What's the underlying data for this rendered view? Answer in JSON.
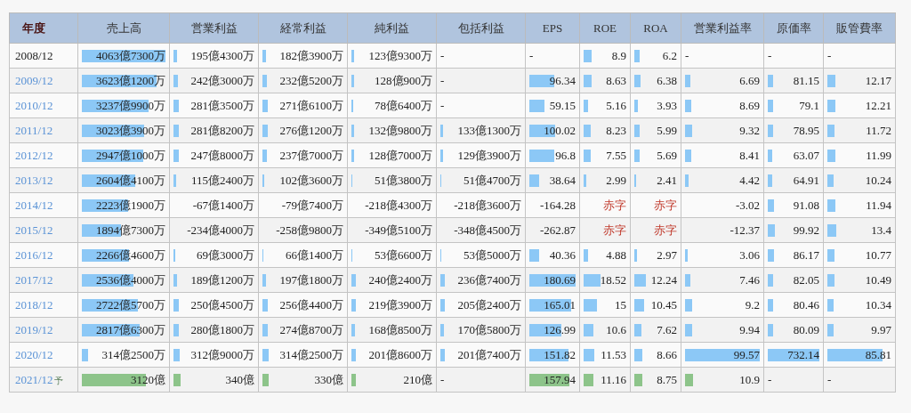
{
  "table": {
    "columns": [
      "年度",
      "売上高",
      "営業利益",
      "経常利益",
      "純利益",
      "包括利益",
      "EPS",
      "ROE",
      "ROA",
      "営業利益率",
      "原価率",
      "販管費率"
    ],
    "rows": [
      {
        "kind": "actual",
        "cells": [
          {
            "kind": "year",
            "text": "2008/12",
            "linked": false
          },
          {
            "kind": "value",
            "text": "4063億7300万",
            "level": 1.0
          },
          {
            "kind": "value",
            "text": "195億4300万",
            "level": 0.048
          },
          {
            "kind": "value",
            "text": "182億3900万",
            "level": 0.045
          },
          {
            "kind": "value",
            "text": "123億9300万",
            "level": 0.03
          },
          {
            "kind": "empty",
            "text": "-"
          },
          {
            "kind": "empty",
            "text": "-"
          },
          {
            "kind": "value",
            "text": "8.9",
            "level": 0.185
          },
          {
            "kind": "value",
            "text": "6.2",
            "level": 0.135
          },
          {
            "kind": "empty",
            "text": "-"
          },
          {
            "kind": "empty",
            "text": "-"
          },
          {
            "kind": "empty",
            "text": "-"
          }
        ]
      },
      {
        "kind": "actual",
        "cells": [
          {
            "kind": "year",
            "text": "2009/12",
            "linked": true
          },
          {
            "kind": "value",
            "text": "3623億1200万",
            "level": 0.89
          },
          {
            "kind": "value",
            "text": "242億3000万",
            "level": 0.06
          },
          {
            "kind": "value",
            "text": "232億5200万",
            "level": 0.057
          },
          {
            "kind": "value",
            "text": "128億900万",
            "level": 0.032
          },
          {
            "kind": "empty",
            "text": "-"
          },
          {
            "kind": "value",
            "text": "96.34",
            "level": 0.53
          },
          {
            "kind": "value",
            "text": "8.63",
            "level": 0.18
          },
          {
            "kind": "value",
            "text": "6.38",
            "level": 0.14
          },
          {
            "kind": "value",
            "text": "6.69",
            "level": 0.067
          },
          {
            "kind": "value",
            "text": "81.15",
            "level": 0.111
          },
          {
            "kind": "value",
            "text": "12.17",
            "level": 0.122
          }
        ]
      },
      {
        "kind": "actual",
        "cells": [
          {
            "kind": "year",
            "text": "2010/12",
            "linked": true
          },
          {
            "kind": "value",
            "text": "3237億9900万",
            "level": 0.8
          },
          {
            "kind": "value",
            "text": "281億3500万",
            "level": 0.069
          },
          {
            "kind": "value",
            "text": "271億6100万",
            "level": 0.067
          },
          {
            "kind": "value",
            "text": "78億6400万",
            "level": 0.019
          },
          {
            "kind": "empty",
            "text": "-"
          },
          {
            "kind": "value",
            "text": "59.15",
            "level": 0.33
          },
          {
            "kind": "value",
            "text": "5.16",
            "level": 0.11
          },
          {
            "kind": "value",
            "text": "3.93",
            "level": 0.085
          },
          {
            "kind": "value",
            "text": "8.69",
            "level": 0.087
          },
          {
            "kind": "value",
            "text": "79.1",
            "level": 0.108
          },
          {
            "kind": "value",
            "text": "12.21",
            "level": 0.122
          }
        ]
      },
      {
        "kind": "actual",
        "cells": [
          {
            "kind": "year",
            "text": "2011/12",
            "linked": true
          },
          {
            "kind": "value",
            "text": "3023億3900万",
            "level": 0.74
          },
          {
            "kind": "value",
            "text": "281億8200万",
            "level": 0.069
          },
          {
            "kind": "value",
            "text": "276億1200万",
            "level": 0.068
          },
          {
            "kind": "value",
            "text": "132億9800万",
            "level": 0.033
          },
          {
            "kind": "value",
            "text": "133億1300万",
            "level": 0.033
          },
          {
            "kind": "value",
            "text": "100.02",
            "level": 0.55
          },
          {
            "kind": "value",
            "text": "8.23",
            "level": 0.17
          },
          {
            "kind": "value",
            "text": "5.99",
            "level": 0.13
          },
          {
            "kind": "value",
            "text": "9.32",
            "level": 0.093
          },
          {
            "kind": "value",
            "text": "78.95",
            "level": 0.108
          },
          {
            "kind": "value",
            "text": "11.72",
            "level": 0.117
          }
        ]
      },
      {
        "kind": "actual",
        "cells": [
          {
            "kind": "year",
            "text": "2012/12",
            "linked": true
          },
          {
            "kind": "value",
            "text": "2947億1000万",
            "level": 0.73
          },
          {
            "kind": "value",
            "text": "247億8000万",
            "level": 0.061
          },
          {
            "kind": "value",
            "text": "237億7000万",
            "level": 0.058
          },
          {
            "kind": "value",
            "text": "128億7000万",
            "level": 0.032
          },
          {
            "kind": "value",
            "text": "129億3900万",
            "level": 0.032
          },
          {
            "kind": "value",
            "text": "96.8",
            "level": 0.54
          },
          {
            "kind": "value",
            "text": "7.55",
            "level": 0.16
          },
          {
            "kind": "value",
            "text": "5.69",
            "level": 0.124
          },
          {
            "kind": "value",
            "text": "8.41",
            "level": 0.084
          },
          {
            "kind": "value",
            "text": "63.07",
            "level": 0.086
          },
          {
            "kind": "value",
            "text": "11.99",
            "level": 0.12
          }
        ]
      },
      {
        "kind": "actual",
        "cells": [
          {
            "kind": "year",
            "text": "2013/12",
            "linked": true
          },
          {
            "kind": "value",
            "text": "2604億4100万",
            "level": 0.64
          },
          {
            "kind": "value",
            "text": "115億2400万",
            "level": 0.028
          },
          {
            "kind": "value",
            "text": "102億3600万",
            "level": 0.025
          },
          {
            "kind": "value",
            "text": "51億3800万",
            "level": 0.013
          },
          {
            "kind": "value",
            "text": "51億4700万",
            "level": 0.013
          },
          {
            "kind": "value",
            "text": "38.64",
            "level": 0.21
          },
          {
            "kind": "value",
            "text": "2.99",
            "level": 0.06
          },
          {
            "kind": "value",
            "text": "2.41",
            "level": 0.05
          },
          {
            "kind": "value",
            "text": "4.42",
            "level": 0.044
          },
          {
            "kind": "value",
            "text": "64.91",
            "level": 0.089
          },
          {
            "kind": "value",
            "text": "10.24",
            "level": 0.102
          }
        ]
      },
      {
        "kind": "actual",
        "cells": [
          {
            "kind": "year",
            "text": "2014/12",
            "linked": true
          },
          {
            "kind": "value",
            "text": "2223億1900万",
            "level": 0.55
          },
          {
            "kind": "value",
            "text": "-67億1400万"
          },
          {
            "kind": "value",
            "text": "-79億7400万"
          },
          {
            "kind": "value",
            "text": "-218億4300万"
          },
          {
            "kind": "value",
            "text": "-218億3600万"
          },
          {
            "kind": "value",
            "text": "-164.28"
          },
          {
            "kind": "loss",
            "text": "赤字"
          },
          {
            "kind": "loss",
            "text": "赤字"
          },
          {
            "kind": "value",
            "text": "-3.02"
          },
          {
            "kind": "value",
            "text": "91.08",
            "level": 0.124
          },
          {
            "kind": "value",
            "text": "11.94",
            "level": 0.119
          }
        ]
      },
      {
        "kind": "actual",
        "cells": [
          {
            "kind": "year",
            "text": "2015/12",
            "linked": true
          },
          {
            "kind": "value",
            "text": "1894億7300万",
            "level": 0.47
          },
          {
            "kind": "value",
            "text": "-234億4000万"
          },
          {
            "kind": "value",
            "text": "-258億9800万"
          },
          {
            "kind": "value",
            "text": "-349億5100万"
          },
          {
            "kind": "value",
            "text": "-348億4500万"
          },
          {
            "kind": "value",
            "text": "-262.87"
          },
          {
            "kind": "loss",
            "text": "赤字"
          },
          {
            "kind": "loss",
            "text": "赤字"
          },
          {
            "kind": "value",
            "text": "-12.37"
          },
          {
            "kind": "value",
            "text": "99.92",
            "level": 0.136
          },
          {
            "kind": "value",
            "text": "13.4",
            "level": 0.134
          }
        ]
      },
      {
        "kind": "actual",
        "cells": [
          {
            "kind": "year",
            "text": "2016/12",
            "linked": true
          },
          {
            "kind": "value",
            "text": "2266億4600万",
            "level": 0.56
          },
          {
            "kind": "value",
            "text": "69億3000万",
            "level": 0.017
          },
          {
            "kind": "value",
            "text": "66億1400万",
            "level": 0.016
          },
          {
            "kind": "value",
            "text": "53億6600万",
            "level": 0.013
          },
          {
            "kind": "value",
            "text": "53億5000万",
            "level": 0.013
          },
          {
            "kind": "value",
            "text": "40.36",
            "level": 0.22
          },
          {
            "kind": "value",
            "text": "4.88",
            "level": 0.1
          },
          {
            "kind": "value",
            "text": "2.97",
            "level": 0.065
          },
          {
            "kind": "value",
            "text": "3.06",
            "level": 0.031
          },
          {
            "kind": "value",
            "text": "86.17",
            "level": 0.118
          },
          {
            "kind": "value",
            "text": "10.77",
            "level": 0.108
          }
        ]
      },
      {
        "kind": "actual",
        "cells": [
          {
            "kind": "year",
            "text": "2017/12",
            "linked": true
          },
          {
            "kind": "value",
            "text": "2536億4000万",
            "level": 0.62
          },
          {
            "kind": "value",
            "text": "189億1200万",
            "level": 0.047
          },
          {
            "kind": "value",
            "text": "197億1800万",
            "level": 0.048
          },
          {
            "kind": "value",
            "text": "240億2400万",
            "level": 0.059
          },
          {
            "kind": "value",
            "text": "236億7400万",
            "level": 0.058
          },
          {
            "kind": "value",
            "text": "180.69",
            "level": 1.0
          },
          {
            "kind": "value",
            "text": "18.52",
            "level": 0.39
          },
          {
            "kind": "value",
            "text": "12.24",
            "level": 0.27
          },
          {
            "kind": "value",
            "text": "7.46",
            "level": 0.075
          },
          {
            "kind": "value",
            "text": "82.05",
            "level": 0.112
          },
          {
            "kind": "value",
            "text": "10.49",
            "level": 0.105
          }
        ]
      },
      {
        "kind": "actual",
        "cells": [
          {
            "kind": "year",
            "text": "2018/12",
            "linked": true
          },
          {
            "kind": "value",
            "text": "2722億5700万",
            "level": 0.67
          },
          {
            "kind": "value",
            "text": "250億4500万",
            "level": 0.062
          },
          {
            "kind": "value",
            "text": "256億4400万",
            "level": 0.063
          },
          {
            "kind": "value",
            "text": "219億3900万",
            "level": 0.054
          },
          {
            "kind": "value",
            "text": "205億2400万",
            "level": 0.05
          },
          {
            "kind": "value",
            "text": "165.01",
            "level": 0.91
          },
          {
            "kind": "value",
            "text": "15",
            "level": 0.31
          },
          {
            "kind": "value",
            "text": "10.45",
            "level": 0.23
          },
          {
            "kind": "value",
            "text": "9.2",
            "level": 0.092
          },
          {
            "kind": "value",
            "text": "80.46",
            "level": 0.11
          },
          {
            "kind": "value",
            "text": "10.34",
            "level": 0.103
          }
        ]
      },
      {
        "kind": "actual",
        "cells": [
          {
            "kind": "year",
            "text": "2019/12",
            "linked": true
          },
          {
            "kind": "value",
            "text": "2817億6300万",
            "level": 0.69
          },
          {
            "kind": "value",
            "text": "280億1800万",
            "level": 0.069
          },
          {
            "kind": "value",
            "text": "274億8700万",
            "level": 0.067
          },
          {
            "kind": "value",
            "text": "168億8500万",
            "level": 0.041
          },
          {
            "kind": "value",
            "text": "170億5800万",
            "level": 0.042
          },
          {
            "kind": "value",
            "text": "126.99",
            "level": 0.7
          },
          {
            "kind": "value",
            "text": "10.6",
            "level": 0.22
          },
          {
            "kind": "value",
            "text": "7.62",
            "level": 0.166
          },
          {
            "kind": "value",
            "text": "9.94",
            "level": 0.099
          },
          {
            "kind": "value",
            "text": "80.09",
            "level": 0.109
          },
          {
            "kind": "value",
            "text": "9.97",
            "level": 0.1
          }
        ]
      },
      {
        "kind": "actual",
        "cells": [
          {
            "kind": "year",
            "text": "2020/12",
            "linked": true
          },
          {
            "kind": "value",
            "text": "314億2500万",
            "level": 0.077
          },
          {
            "kind": "value",
            "text": "312億9000万",
            "level": 0.077
          },
          {
            "kind": "value",
            "text": "314億2500万",
            "level": 0.077
          },
          {
            "kind": "value",
            "text": "201億8600万",
            "level": 0.05
          },
          {
            "kind": "value",
            "text": "201億7400万",
            "level": 0.05
          },
          {
            "kind": "value",
            "text": "151.82",
            "level": 0.84
          },
          {
            "kind": "value",
            "text": "11.53",
            "level": 0.24
          },
          {
            "kind": "value",
            "text": "8.66",
            "level": 0.19
          },
          {
            "kind": "value",
            "text": "99.57",
            "level": 0.996
          },
          {
            "kind": "value",
            "text": "732.14",
            "level": 1.0
          },
          {
            "kind": "value",
            "text": "85.81",
            "level": 0.858
          }
        ]
      },
      {
        "kind": "forecast",
        "cells": [
          {
            "kind": "year",
            "text": "2021/12",
            "note": "予",
            "linked": true
          },
          {
            "kind": "value",
            "text": "3120億",
            "level": 0.77
          },
          {
            "kind": "value",
            "text": "340億",
            "level": 0.084
          },
          {
            "kind": "value",
            "text": "330億",
            "level": 0.081
          },
          {
            "kind": "value",
            "text": "210億",
            "level": 0.052
          },
          {
            "kind": "empty",
            "text": "-"
          },
          {
            "kind": "value",
            "text": "157.94",
            "level": 0.87
          },
          {
            "kind": "value",
            "text": "11.16",
            "level": 0.23
          },
          {
            "kind": "value",
            "text": "8.75",
            "level": 0.19
          },
          {
            "kind": "value",
            "text": "10.9",
            "level": 0.109
          },
          {
            "kind": "empty",
            "text": "-"
          },
          {
            "kind": "empty",
            "text": "-"
          }
        ]
      }
    ]
  }
}
